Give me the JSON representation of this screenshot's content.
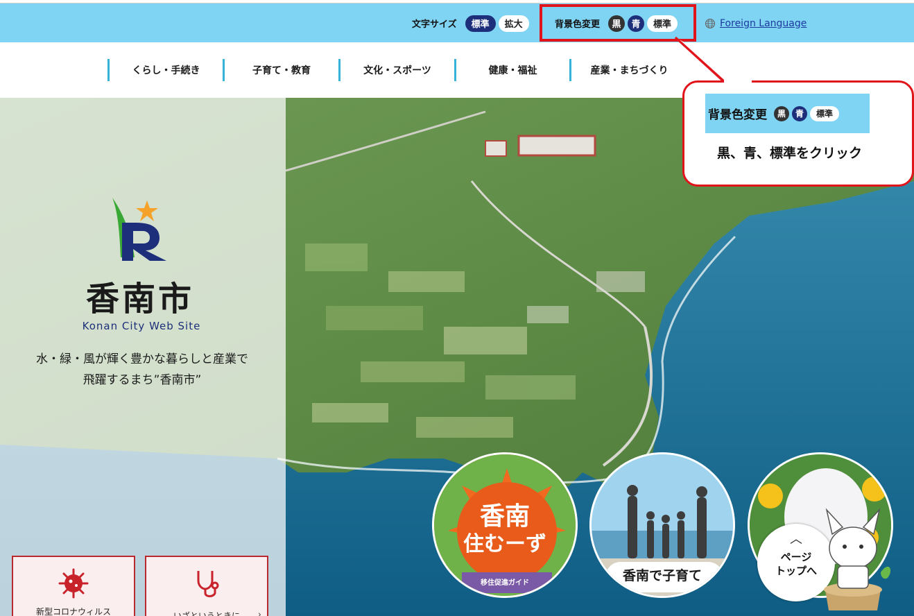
{
  "topbar": {
    "font_size_label": "文字サイズ",
    "font_size_standard": "標準",
    "font_size_large": "拡大",
    "bg_color_label": "背景色変更",
    "bg_black": "黒",
    "bg_blue": "青",
    "bg_standard": "標準",
    "foreign_language": "Foreign Language",
    "globe_icon": "globe-icon"
  },
  "nav": {
    "items": [
      {
        "label": "くらし・手続き"
      },
      {
        "label": "子育て・教育"
      },
      {
        "label": "文化・スポーツ"
      },
      {
        "label": "健康・福祉"
      },
      {
        "label": "産業・まちづくり"
      }
    ]
  },
  "hero": {
    "city_name": "香南市",
    "city_en": "Konan City Web Site",
    "tagline_line1": "水・緑・風が輝く豊かな暮らしと産業で",
    "tagline_line2": "飛躍するまち”香南市”",
    "quick_links": [
      {
        "label": "新型コロナウィルス",
        "icon": "virus-icon"
      },
      {
        "label": "いざというときに",
        "icon": "stethoscope-icon"
      }
    ],
    "banners": [
      {
        "title_top": "香南",
        "title_bottom": "住むーず",
        "subtitle": "移住促進ガイド"
      },
      {
        "label": "香南で子育て"
      }
    ]
  },
  "callout": {
    "bg_label": "背景色変更",
    "black": "黒",
    "blue": "青",
    "standard": "標準",
    "note": "黒、青、標準をクリック"
  },
  "pagetop": {
    "chevron": "︿",
    "line1": "ページ",
    "line2": "トップへ"
  },
  "colors": {
    "topbar": "#7fd4f3",
    "navy": "#1d2f7a",
    "nav_accent": "#35b3d9",
    "highlight_red": "#e1141b",
    "quick_border": "#b9282e"
  }
}
